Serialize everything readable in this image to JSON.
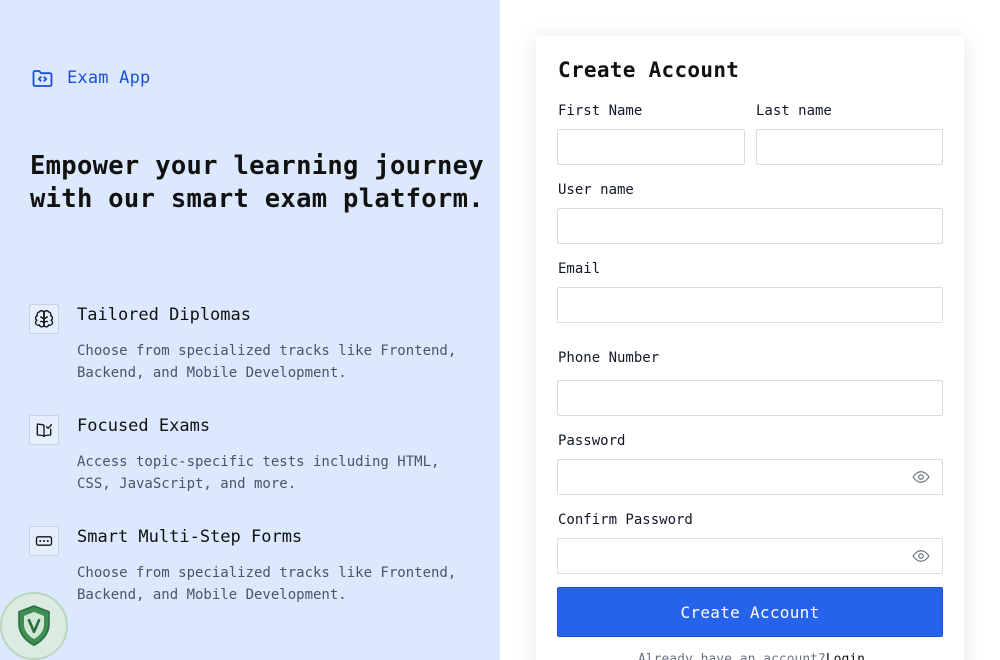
{
  "brand": {
    "name": "Exam App",
    "icon": "folder-code-icon"
  },
  "hero": {
    "headline": "Empower your learning journey with our smart exam platform."
  },
  "features": [
    {
      "icon": "brain-icon",
      "title": "Tailored Diplomas",
      "description": "Choose from specialized tracks like Frontend, Backend, and Mobile Development."
    },
    {
      "icon": "book-check-icon",
      "title": "Focused Exams",
      "description": "Access topic-specific tests including HTML, CSS, JavaScript, and more."
    },
    {
      "icon": "form-input-icon",
      "title": "Smart Multi-Step Forms",
      "description": "Choose from specialized tracks like Frontend, Backend, and Mobile Development."
    }
  ],
  "form": {
    "title": "Create Account",
    "first_name": {
      "label": "First Name",
      "value": "",
      "placeholder": ""
    },
    "last_name": {
      "label": "Last name",
      "value": "",
      "placeholder": ""
    },
    "username": {
      "label": "User name",
      "value": "",
      "placeholder": ""
    },
    "email": {
      "label": "Email",
      "value": "",
      "placeholder": ""
    },
    "phone": {
      "label": "Phone Number",
      "value": "",
      "placeholder": ""
    },
    "password": {
      "label": "Password",
      "value": "",
      "placeholder": "",
      "toggle_icon": "eye-icon"
    },
    "confirm_password": {
      "label": "Confirm Password",
      "value": "",
      "placeholder": "",
      "toggle_icon": "eye-icon"
    },
    "submit_label": "Create Account",
    "footer_text": "Already have an account?",
    "login_link": "Login"
  },
  "colors": {
    "left_panel_bg": "#dbe8fe",
    "accent": "#2563eb",
    "brand_text": "#1d4ed8"
  }
}
